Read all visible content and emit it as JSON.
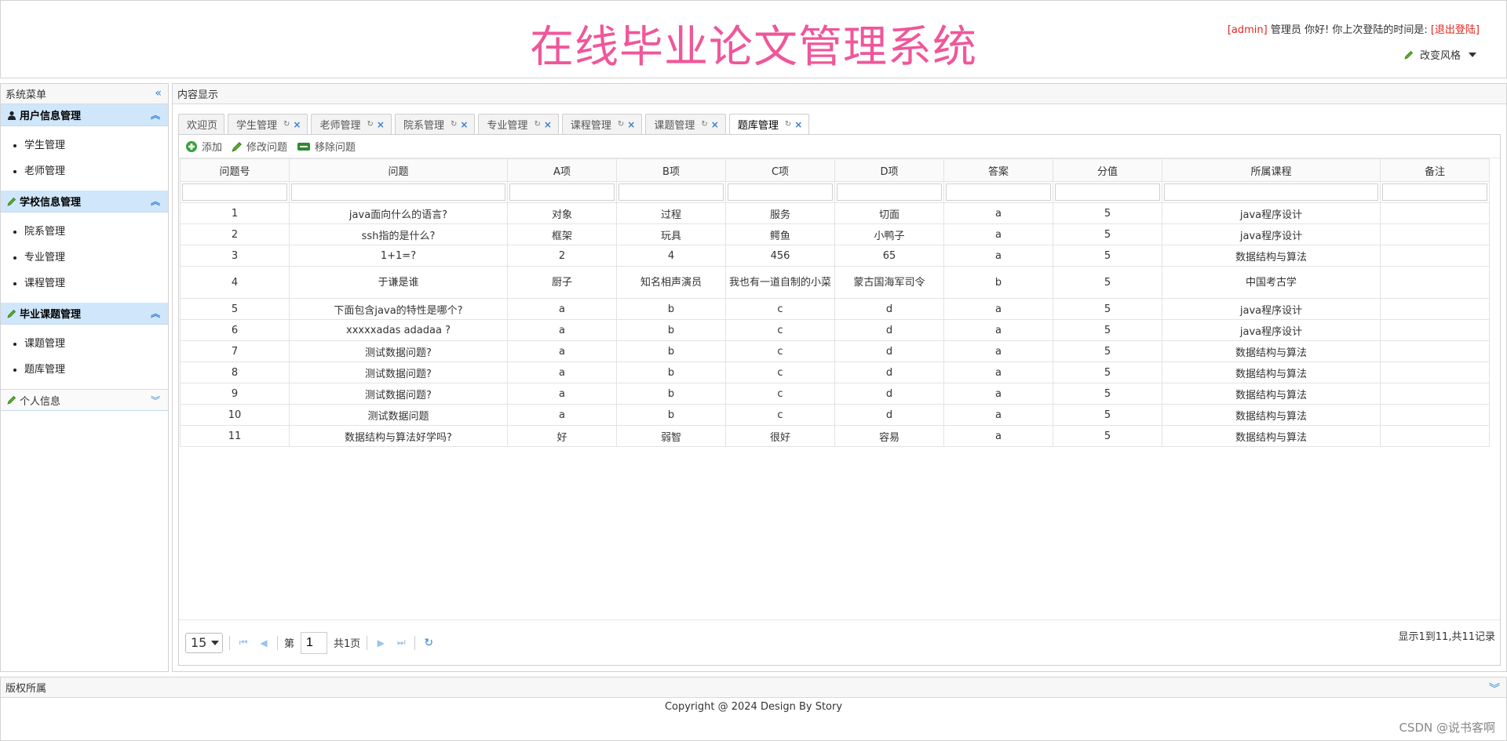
{
  "header": {
    "title": "在线毕业论文管理系统",
    "user_name": "[admin]",
    "greeting": " 管理员 你好! 你上次登陆的时间是: ",
    "logout": "[退出登陆]",
    "style_switch": "改变风格"
  },
  "sidebar": {
    "title": "系统菜单",
    "groups": [
      {
        "title": "用户信息管理",
        "items": [
          "学生管理",
          "老师管理"
        ]
      },
      {
        "title": "学校信息管理",
        "items": [
          "院系管理",
          "专业管理",
          "课程管理"
        ]
      },
      {
        "title": "毕业课题管理",
        "items": [
          "课题管理",
          "题库管理"
        ]
      },
      {
        "title": "个人信息",
        "items": []
      }
    ]
  },
  "content": {
    "title": "内容显示",
    "tabs": [
      "欢迎页",
      "学生管理",
      "老师管理",
      "院系管理",
      "专业管理",
      "课程管理",
      "课题管理",
      "题库管理"
    ],
    "active_tab": "题库管理",
    "toolbar": {
      "add": "添加",
      "edit": "修改问题",
      "remove": "移除问题"
    },
    "columns": [
      "问题号",
      "问题",
      "A项",
      "B项",
      "C项",
      "D项",
      "答案",
      "分值",
      "所属课程",
      "备注"
    ],
    "rows": [
      [
        "1",
        "java面向什么的语言?",
        "对象",
        "过程",
        "服务",
        "切面",
        "a",
        "5",
        "java程序设计",
        ""
      ],
      [
        "2",
        "ssh指的是什么?",
        "框架",
        "玩具",
        "鳄鱼",
        "小鸭子",
        "a",
        "5",
        "java程序设计",
        ""
      ],
      [
        "3",
        "1+1=?",
        "2",
        "4",
        "456",
        "65",
        "a",
        "5",
        "数据结构与算法",
        ""
      ],
      [
        "4",
        "于谦是谁",
        "厨子",
        "知名相声演员",
        "我也有一道自制的小菜",
        "蒙古国海军司令",
        "b",
        "5",
        "中国考古学",
        ""
      ],
      [
        "5",
        "下面包含java的特性是哪个?",
        "a",
        "b",
        "c",
        "d",
        "a",
        "5",
        "java程序设计",
        ""
      ],
      [
        "6",
        "xxxxxadas adadaa ?",
        "a",
        "b",
        "c",
        "d",
        "a",
        "5",
        "java程序设计",
        ""
      ],
      [
        "7",
        "测试数据问题?",
        "a",
        "b",
        "c",
        "d",
        "a",
        "5",
        "数据结构与算法",
        ""
      ],
      [
        "8",
        "测试数据问题?",
        "a",
        "b",
        "c",
        "d",
        "a",
        "5",
        "数据结构与算法",
        ""
      ],
      [
        "9",
        "测试数据问题?",
        "a",
        "b",
        "c",
        "d",
        "a",
        "5",
        "数据结构与算法",
        ""
      ],
      [
        "10",
        "测试数据问题",
        "a",
        "b",
        "c",
        "d",
        "a",
        "5",
        "数据结构与算法",
        ""
      ],
      [
        "11",
        "数据结构与算法好学吗?",
        "好",
        "弱智",
        "很好",
        "容易",
        "a",
        "5",
        "数据结构与算法",
        ""
      ]
    ],
    "pager": {
      "page_size": "15",
      "page_prefix": "第",
      "page_value": "1",
      "page_suffix": "共1页",
      "info": "显示1到11,共11记录"
    }
  },
  "footer": {
    "title": "版权所属",
    "copyright": "Copyright @ 2024 Design By Story",
    "watermark": "CSDN @说书客啊"
  }
}
